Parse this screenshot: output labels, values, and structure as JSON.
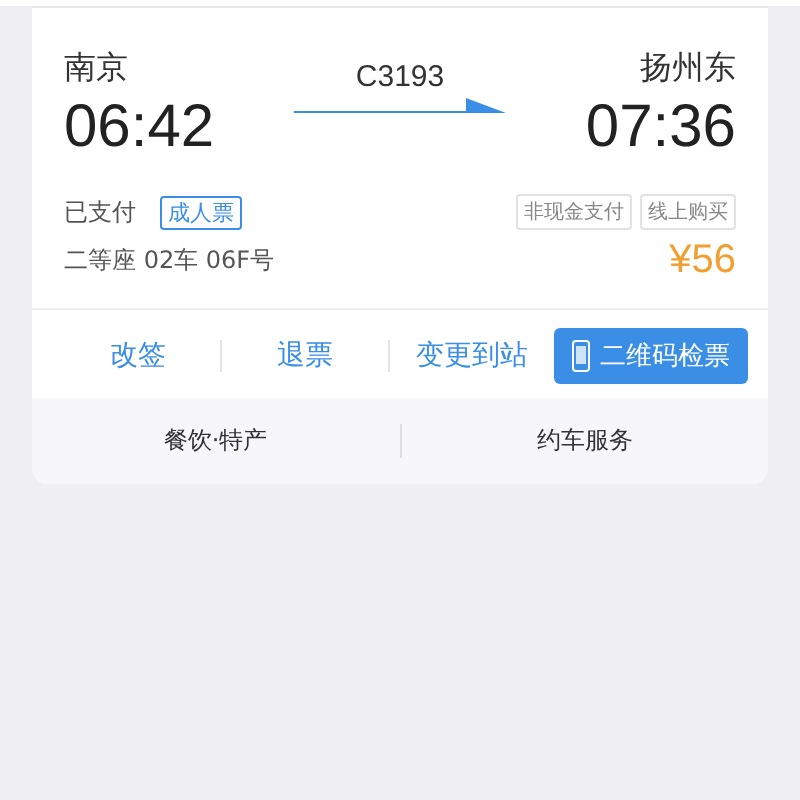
{
  "ticket": {
    "from_station": "南京",
    "from_time": "06:42",
    "train": "C3193",
    "to_station": "扬州东",
    "to_time": "07:36",
    "payment_status": "已支付",
    "ticket_type": "成人票",
    "tags": [
      "非现金支付",
      "线上购买"
    ],
    "seat": "二等座 02车 06F号",
    "price": "¥56"
  },
  "actions": [
    {
      "label": "改签",
      "kind": "link"
    },
    {
      "label": "退票",
      "kind": "link"
    },
    {
      "label": "变更到站",
      "kind": "link"
    },
    {
      "label": "二维码检票",
      "kind": "primary"
    }
  ],
  "services": [
    "餐饮·特产",
    "约车服务"
  ]
}
